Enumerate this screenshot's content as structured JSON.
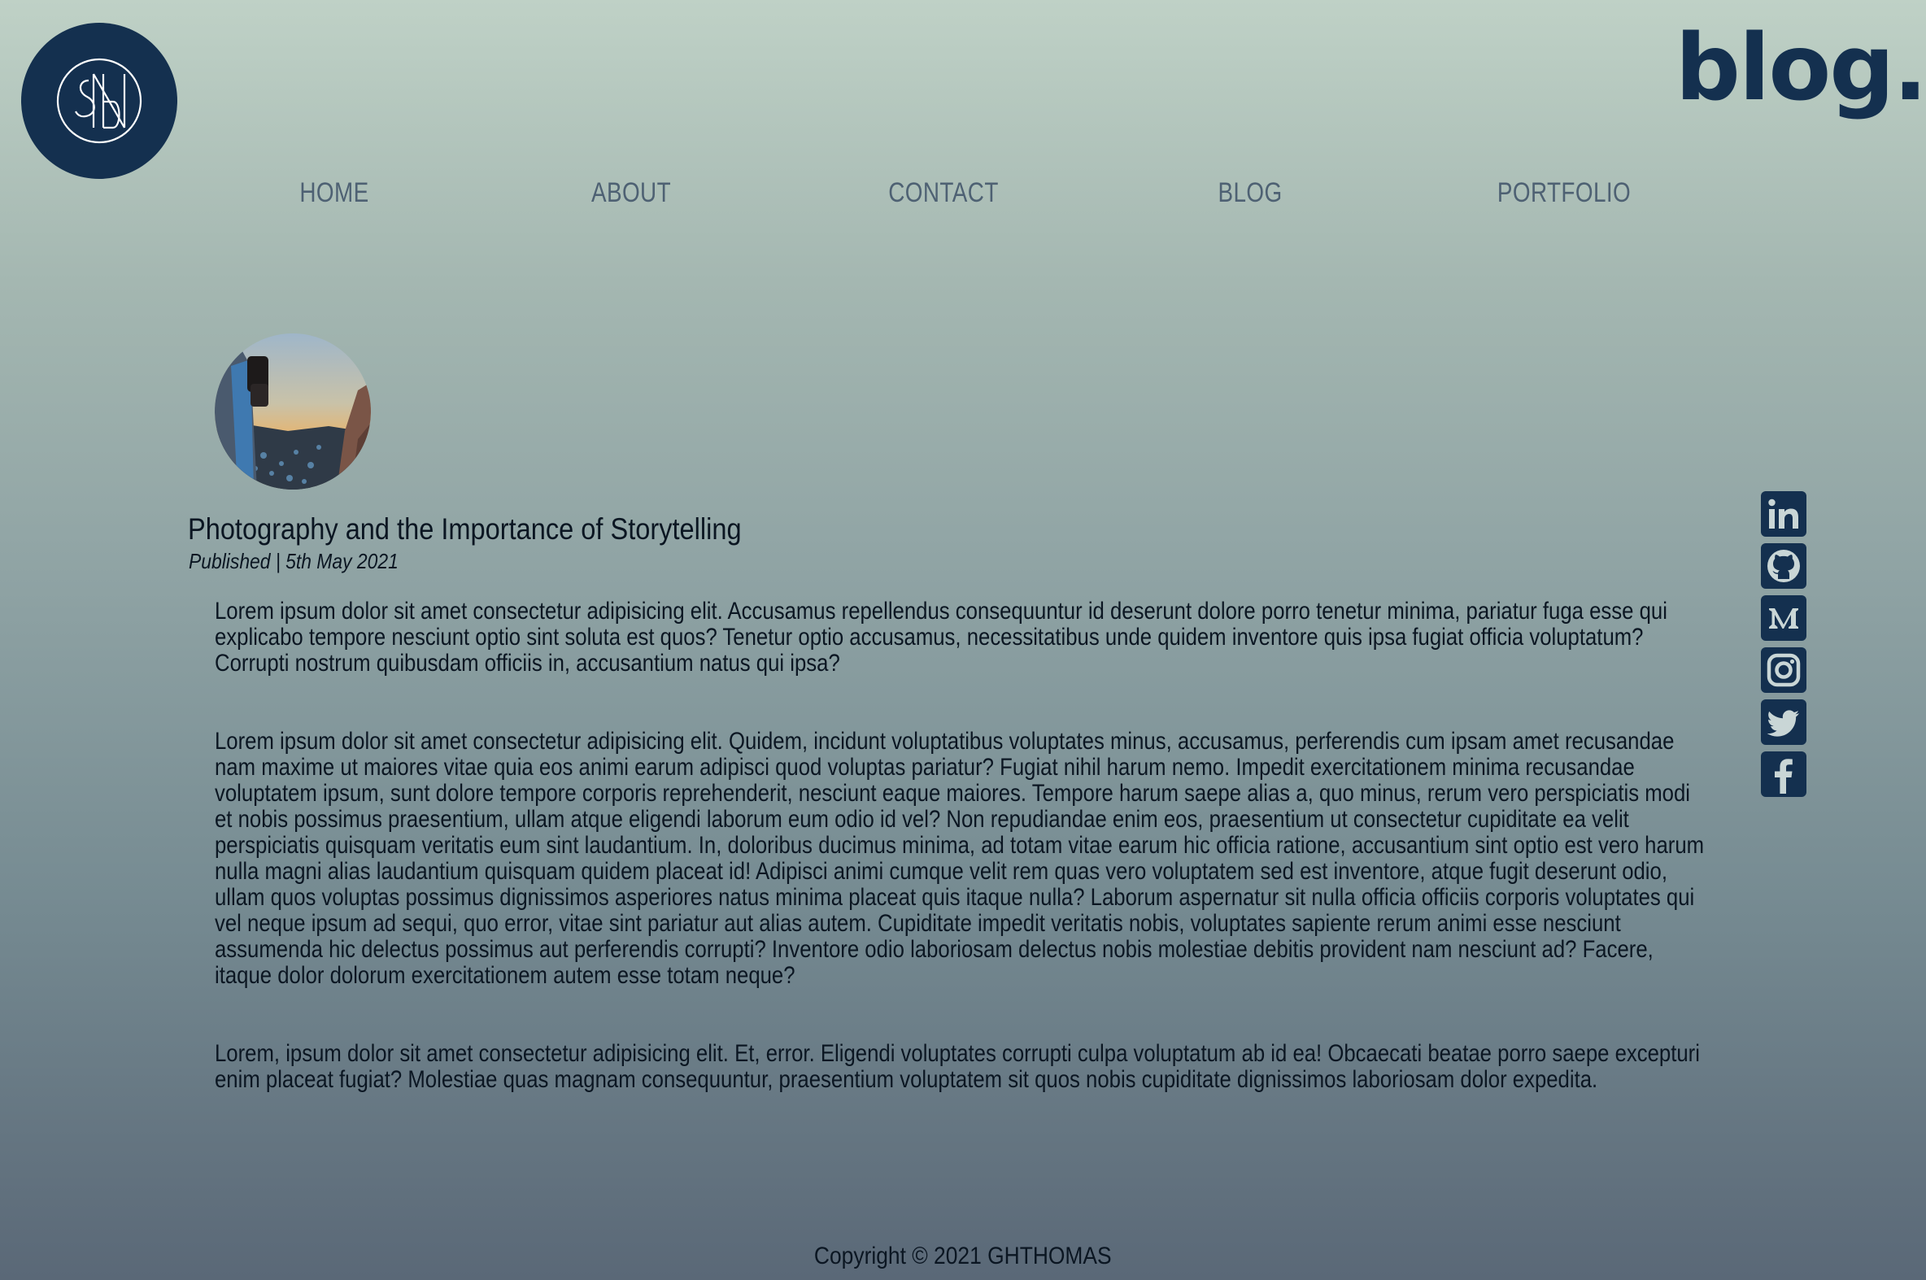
{
  "header": {
    "logo_icon": "monogram-logo-icon",
    "brand": "blog."
  },
  "nav": {
    "items": [
      {
        "label": "HOME"
      },
      {
        "label": "ABOUT"
      },
      {
        "label": "CONTACT"
      },
      {
        "label": "BLOG"
      },
      {
        "label": "PORTFOLIO"
      }
    ]
  },
  "post": {
    "image": "photographer-holding-camera-image",
    "title": "Photography and the Importance of Storytelling",
    "published": "Published | 5th May 2021",
    "paragraphs": [
      "Lorem ipsum dolor sit amet consectetur adipisicing elit. Accusamus repellendus consequuntur id deserunt dolore porro tenetur minima, pariatur fuga esse qui explicabo tempore nesciunt optio sint soluta est quos? Tenetur optio accusamus, necessitatibus unde quidem inventore quis ipsa fugiat officia voluptatum? Corrupti nostrum quibusdam officiis in, accusantium natus qui ipsa?",
      "Lorem ipsum dolor sit amet consectetur adipisicing elit. Quidem, incidunt voluptatibus voluptates minus, accusamus, perferendis cum ipsam amet recusandae nam maxime ut maiores vitae quia eos animi earum adipisci quod voluptas pariatur? Fugiat nihil harum nemo. Impedit exercitationem minima recusandae voluptatem ipsum, sunt dolore tempore corporis reprehenderit, nesciunt eaque maiores. Tempore harum saepe alias a, quo minus, rerum vero perspiciatis modi et nobis possimus praesentium, ullam atque eligendi laborum eum odio id vel? Non repudiandae enim eos, praesentium ut consectetur cupiditate ea velit perspiciatis quisquam veritatis eum sint laudantium. In, doloribus ducimus minima, ad totam vitae earum hic officia ratione, accusantium sint optio est vero harum nulla magni alias laudantium quisquam quidem placeat id! Adipisci animi cumque velit rem quas vero voluptatem sed est inventore, atque fugit deserunt odio, ullam quos voluptas possimus dignissimos asperiores natus minima placeat quis itaque nulla? Laborum aspernatur sit nulla officia officiis corporis voluptates qui vel neque ipsum ad sequi, quo error, vitae sint pariatur aut alias autem. Cupiditate impedit veritatis nobis, voluptates sapiente rerum animi esse nesciunt assumenda hic delectus possimus aut perferendis corrupti? Inventore odio laboriosam delectus nobis molestiae debitis provident nam nesciunt ad? Facere, itaque dolor dolorum exercitationem autem esse totam neque?",
      "Lorem, ipsum dolor sit amet consectetur adipisicing elit. Et, error. Eligendi voluptates corrupti culpa voluptatum ab id ea! Obcaecati beatae porro saepe excepturi enim placeat fugiat? Molestiae quas magnam consequuntur, praesentium voluptatem sit quos nobis cupiditate dignissimos laboriosam dolor expedita."
    ]
  },
  "social": {
    "icons": [
      "linkedin-icon",
      "github-icon",
      "medium-icon",
      "instagram-icon",
      "twitter-icon",
      "facebook-icon"
    ]
  },
  "footer": {
    "copyright": "Copyright © 2021 GHTHOMAS"
  },
  "colors": {
    "brand_navy": "#14304f",
    "nav_text": "#4e6173",
    "body_text": "#0b1622",
    "background_top": "#bfd1c6",
    "background_bottom": "#5a6877"
  }
}
